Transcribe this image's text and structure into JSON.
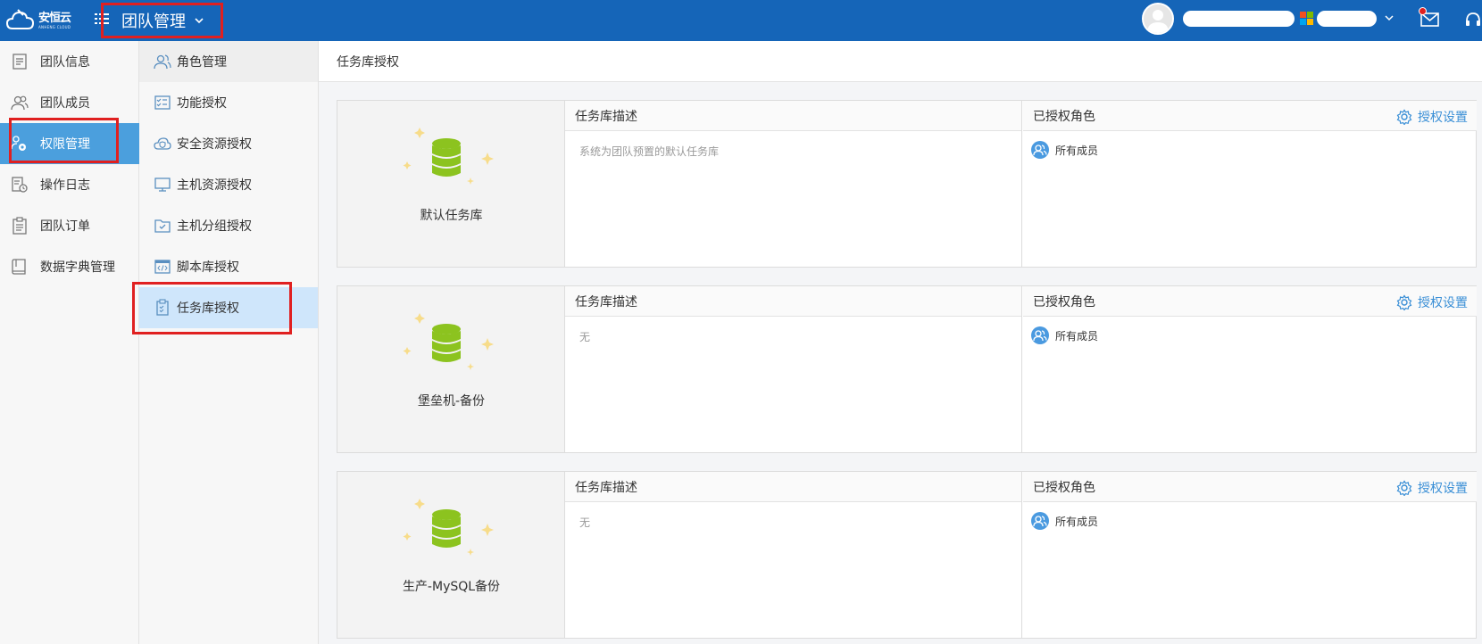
{
  "topbar": {
    "logo_cn": "安恒云",
    "logo_en": "ANHENG CLOUD",
    "module_title": "团队管理",
    "mail_has_notification": true
  },
  "leftnav": {
    "items": [
      {
        "label": "团队信息",
        "icon": "document-icon"
      },
      {
        "label": "团队成员",
        "icon": "users-icon"
      },
      {
        "label": "权限管理",
        "icon": "user-gear-icon",
        "active": true
      },
      {
        "label": "操作日志",
        "icon": "log-icon"
      },
      {
        "label": "团队订单",
        "icon": "clipboard-icon"
      },
      {
        "label": "数据字典管理",
        "icon": "book-icon"
      }
    ]
  },
  "subnav": {
    "items": [
      {
        "label": "角色管理",
        "icon": "users-icon"
      },
      {
        "label": "功能授权",
        "icon": "checklist-icon"
      },
      {
        "label": "安全资源授权",
        "icon": "cloud-shield-icon"
      },
      {
        "label": "主机资源授权",
        "icon": "monitor-icon"
      },
      {
        "label": "主机分组授权",
        "icon": "folder-check-icon"
      },
      {
        "label": "脚本库授权",
        "icon": "code-window-icon"
      },
      {
        "label": "任务库授权",
        "icon": "task-clipboard-icon",
        "active": true
      }
    ]
  },
  "main": {
    "page_title": "任务库授权",
    "cards": [
      {
        "name": "默认任务库",
        "desc_header": "任务库描述",
        "description": "系统为团队预置的默认任务库",
        "roles_header": "已授权角色",
        "roles": [
          "所有成员"
        ],
        "settings_label": "授权设置"
      },
      {
        "name": "堡垒机-备份",
        "desc_header": "任务库描述",
        "description": "无",
        "roles_header": "已授权角色",
        "roles": [
          "所有成员"
        ],
        "settings_label": "授权设置"
      },
      {
        "name": "生产-MySQL备份",
        "desc_header": "任务库描述",
        "description": "无",
        "roles_header": "已授权角色",
        "roles": [
          "所有成员"
        ],
        "settings_label": "授权设置"
      }
    ]
  },
  "colors": {
    "topbar": "#1565b8",
    "active_nav": "#4b9fdd",
    "active_subnav": "#cfe6fb",
    "highlight_box": "#e02020",
    "database_green": "#8cc31f",
    "sparkle": "#f7dc8a",
    "link_blue": "#3a8fd6"
  }
}
